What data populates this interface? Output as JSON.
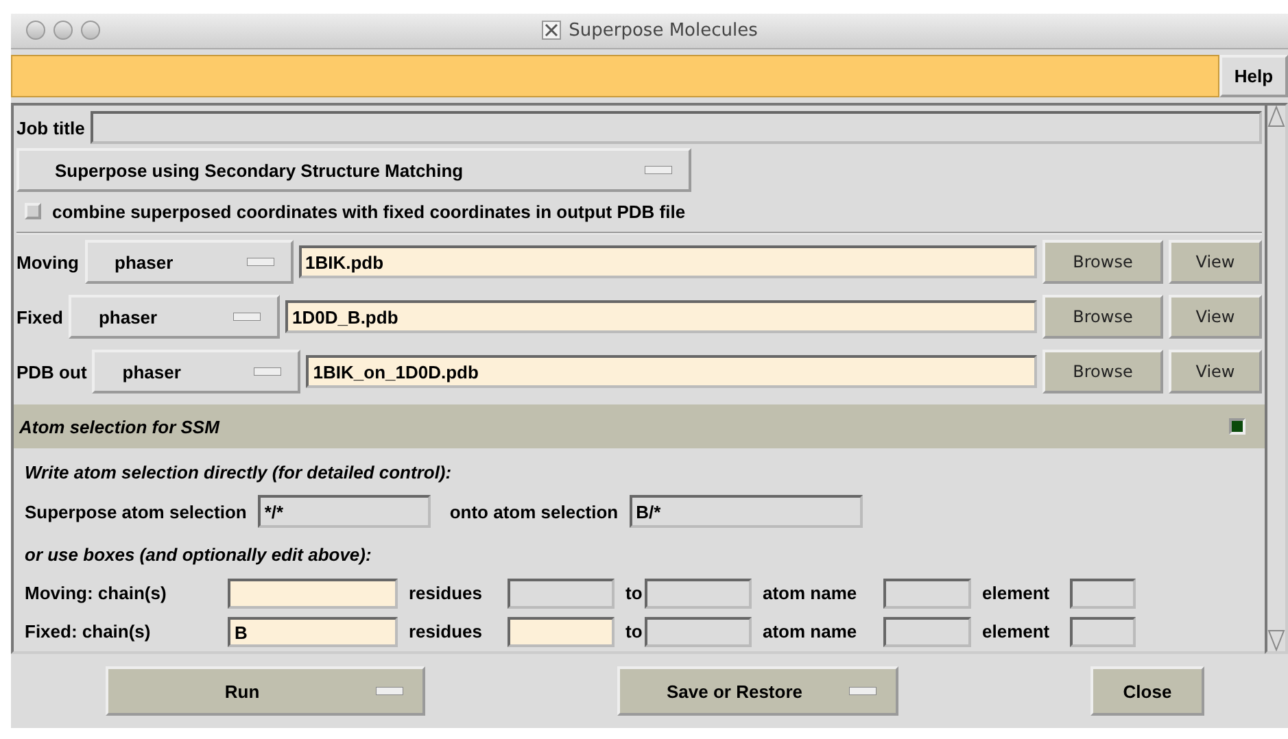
{
  "window": {
    "title": "Superpose Molecules"
  },
  "help_button": "Help",
  "job_title": {
    "label": "Job title"
  },
  "mode_menu": "Superpose using Secondary Structure Matching",
  "combine_option": {
    "label": "combine superposed coordinates with fixed coordinates in output PDB file",
    "checked": false
  },
  "files": [
    {
      "label": "Moving",
      "source": "phaser",
      "filename": "1BIK.pdb",
      "browse": "Browse",
      "view": "View"
    },
    {
      "label": "Fixed",
      "source": "phaser",
      "filename": "1D0D_B.pdb",
      "browse": "Browse",
      "view": "View"
    },
    {
      "label": "PDB out",
      "source": "phaser",
      "filename": "1BIK_on_1D0D.pdb",
      "browse": "Browse",
      "view": "View"
    }
  ],
  "atom_section": {
    "title": "Atom selection for SSM",
    "checked": true,
    "direct_hint": "Write atom selection directly (for detailed control):",
    "superpose_label": "Superpose atom selection",
    "superpose_value": "*/*",
    "onto_label": "onto atom selection",
    "onto_value": "B/*",
    "boxes_hint": "or use boxes (and optionally edit above):",
    "chains": [
      {
        "cells": [
          {
            "kind": "label",
            "text": "Moving: chain(s)"
          },
          {
            "kind": "field",
            "highlighted": true
          },
          {
            "kind": "label",
            "text": "residues"
          },
          {
            "kind": "field",
            "highlighted": false
          },
          {
            "kind": "label",
            "text": "to"
          },
          {
            "kind": "field",
            "highlighted": false
          },
          {
            "kind": "label",
            "text": "atom name"
          },
          {
            "kind": "field",
            "highlighted": false
          },
          {
            "kind": "label",
            "text": "element"
          },
          {
            "kind": "field",
            "highlighted": false
          }
        ]
      },
      {
        "cells": [
          {
            "kind": "label",
            "text": "Fixed: chain(s)"
          },
          {
            "kind": "field",
            "value": "B",
            "highlighted": true
          },
          {
            "kind": "label",
            "text": "residues"
          },
          {
            "kind": "field",
            "highlighted": true
          },
          {
            "kind": "label",
            "text": "to"
          },
          {
            "kind": "field",
            "highlighted": false
          },
          {
            "kind": "label",
            "text": "atom name"
          },
          {
            "kind": "field",
            "highlighted": false
          },
          {
            "kind": "label",
            "text": "element"
          },
          {
            "kind": "field",
            "highlighted": false
          }
        ]
      }
    ]
  },
  "buttons": [
    {
      "label": "Run",
      "menu": true
    },
    {
      "label": "Save or Restore",
      "menu": true
    },
    {
      "label": "Close",
      "menu": false
    }
  ]
}
